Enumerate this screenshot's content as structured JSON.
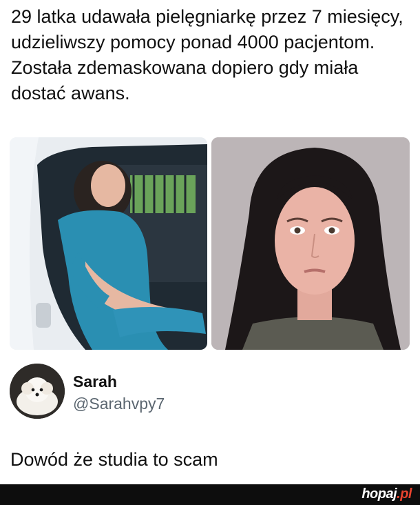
{
  "post": {
    "headline": "29 latka udawała pielęgniarkę przez 7 miesięcy, udzieliwszy pomocy ponad 4000 pacjentom. Została zdemaskowana dopiero gdy miała dostać awans."
  },
  "images": [
    {
      "icon": "photo-car-scrubs"
    },
    {
      "icon": "photo-mugshot"
    }
  ],
  "tweet": {
    "avatar_icon": "dog-avatar-icon",
    "display_name": "Sarah",
    "handle": "@Sarahvpy7",
    "text": "Dowód że studia to scam"
  },
  "footer": {
    "watermark_main": "hopaj",
    "watermark_tld": ".pl"
  },
  "colors": {
    "background": "#ffffff",
    "footer_bar": "#0d0d0d",
    "watermark_accent": "#e8432e",
    "handle_gray": "#5b6670"
  }
}
